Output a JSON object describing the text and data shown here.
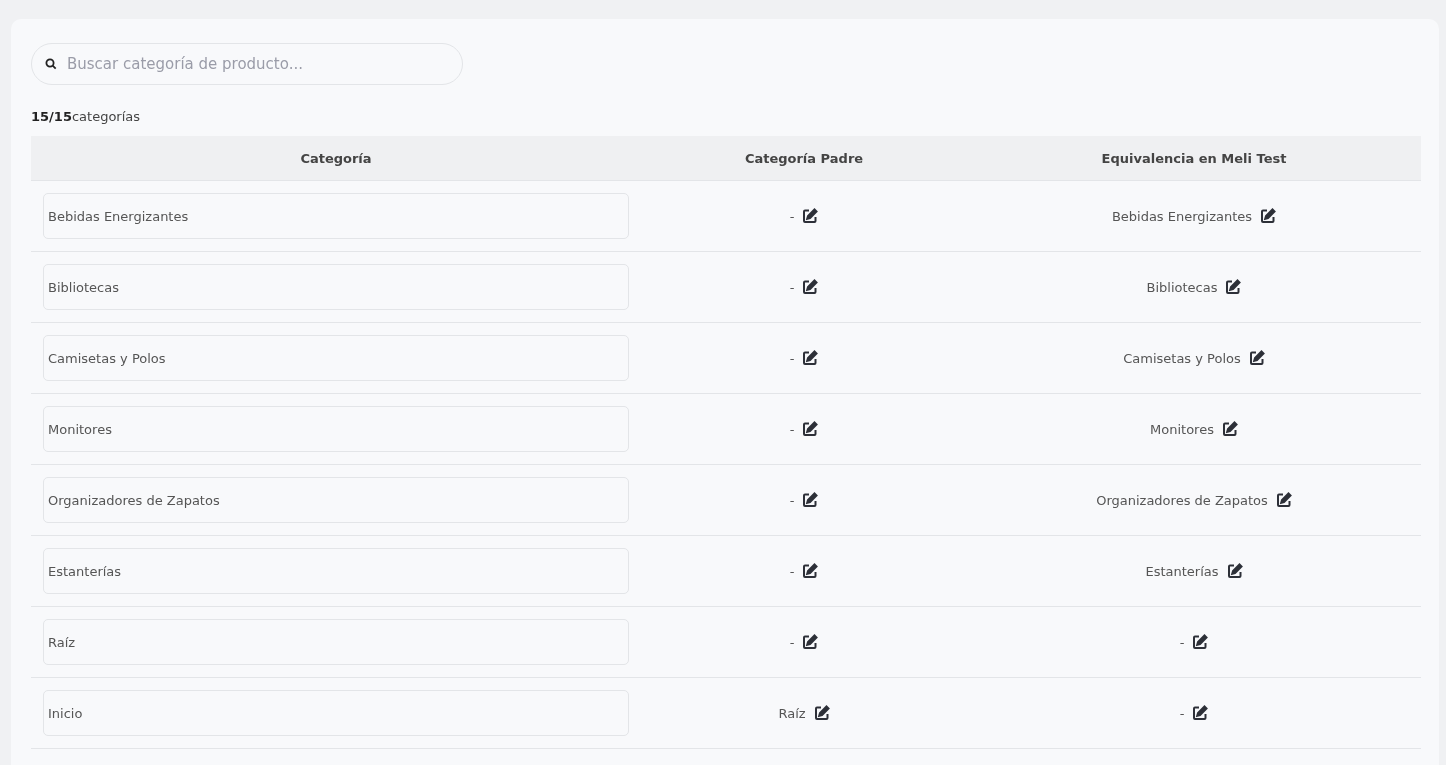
{
  "search": {
    "placeholder": "Buscar categoría de producto..."
  },
  "counter": "**15/15**categorías",
  "table": {
    "columns": [
      "Categoría",
      "Categoría Padre",
      "Equivalencia en Meli Test"
    ],
    "rows": [
      {
        "category": "Bebidas Energizantes",
        "parent": "-",
        "equivalence": "Bebidas Energizantes"
      },
      {
        "category": "Bibliotecas",
        "parent": "-",
        "equivalence": "Bibliotecas"
      },
      {
        "category": "Camisetas y Polos",
        "parent": "-",
        "equivalence": "Camisetas y Polos"
      },
      {
        "category": "Monitores",
        "parent": "-",
        "equivalence": "Monitores"
      },
      {
        "category": "Organizadores de Zapatos",
        "parent": "-",
        "equivalence": "Organizadores de Zapatos"
      },
      {
        "category": "Estanterías",
        "parent": "-",
        "equivalence": "Estanterías"
      },
      {
        "category": "Raíz",
        "parent": "-",
        "equivalence": "-"
      },
      {
        "category": "Inicio",
        "parent": "Raíz",
        "equivalence": "-"
      }
    ]
  }
}
